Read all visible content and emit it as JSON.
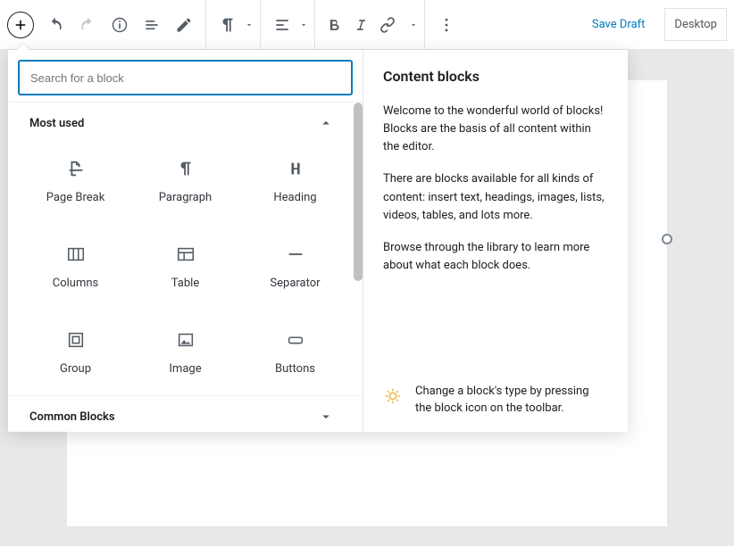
{
  "toolbar": {
    "save_draft": "Save Draft",
    "preview_mode": "Desktop"
  },
  "inserter": {
    "search_placeholder": "Search for a block",
    "categories": {
      "most_used": {
        "label": "Most used",
        "expanded": true,
        "blocks": [
          {
            "label": "Page Break"
          },
          {
            "label": "Paragraph"
          },
          {
            "label": "Heading"
          },
          {
            "label": "Columns"
          },
          {
            "label": "Table"
          },
          {
            "label": "Separator"
          },
          {
            "label": "Group"
          },
          {
            "label": "Image"
          },
          {
            "label": "Buttons"
          }
        ]
      },
      "common": {
        "label": "Common Blocks",
        "expanded": false
      }
    },
    "content_blocks": {
      "title": "Content blocks",
      "p1": "Welcome to the wonderful world of blocks! Blocks are the basis of all content within the editor.",
      "p2": "There are blocks available for all kinds of content: insert text, headings, images, lists, videos, tables, and lots more.",
      "p3": "Browse through the library to learn more about what each block does.",
      "tip": "Change a block's type by pressing the block icon on the toolbar."
    }
  }
}
